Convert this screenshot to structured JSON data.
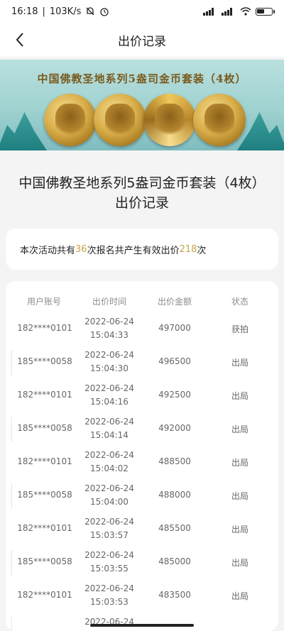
{
  "status_bar": {
    "time": "16:18",
    "separator": "|",
    "speed": "103K/s",
    "battery_level": 0.55
  },
  "nav": {
    "title": "出价记录"
  },
  "banner": {
    "title": "中国佛教圣地系列5盎司金币套装（4枚）"
  },
  "page": {
    "title_line1": "中国佛教圣地系列5盎司金币套装（4枚）",
    "title_line2": "出价记录"
  },
  "summary": {
    "prefix": "本次活动共有",
    "signups": "36",
    "middle": "次报名共产生有效出价",
    "bids": "218",
    "suffix": "次"
  },
  "table": {
    "headers": [
      "用户账号",
      "出价时间",
      "出价金额",
      "状态"
    ],
    "rows": [
      {
        "user": "182****0101",
        "date": "2022-06-24",
        "time": "15:04:33",
        "amount": "497000",
        "status": "获拍"
      },
      {
        "user": "185****0058",
        "date": "2022-06-24",
        "time": "15:04:30",
        "amount": "496500",
        "status": "出局"
      },
      {
        "user": "182****0101",
        "date": "2022-06-24",
        "time": "15:04:16",
        "amount": "492500",
        "status": "出局"
      },
      {
        "user": "185****0058",
        "date": "2022-06-24",
        "time": "15:04:14",
        "amount": "492000",
        "status": "出局"
      },
      {
        "user": "182****0101",
        "date": "2022-06-24",
        "time": "15:04:02",
        "amount": "488500",
        "status": "出局"
      },
      {
        "user": "185****0058",
        "date": "2022-06-24",
        "time": "15:04:00",
        "amount": "488000",
        "status": "出局"
      },
      {
        "user": "182****0101",
        "date": "2022-06-24",
        "time": "15:03:57",
        "amount": "485500",
        "status": "出局"
      },
      {
        "user": "185****0058",
        "date": "2022-06-24",
        "time": "15:03:55",
        "amount": "485000",
        "status": "出局"
      },
      {
        "user": "182****0101",
        "date": "2022-06-24",
        "time": "15:03:53",
        "amount": "483500",
        "status": "出局"
      },
      {
        "user": "",
        "date": "2022-06-24",
        "time": "",
        "amount": "",
        "status": ""
      }
    ]
  },
  "colors": {
    "highlight": "#c9a447",
    "banner_teal": "#9fd2d0",
    "banner_title": "#7a5a1e"
  },
  "icons": {
    "back": "chevron-left-icon",
    "mute": "bell-off-icon",
    "alarm": "alarm-icon",
    "signal": "signal-icon",
    "wifi": "wifi-icon",
    "battery": "battery-icon"
  }
}
